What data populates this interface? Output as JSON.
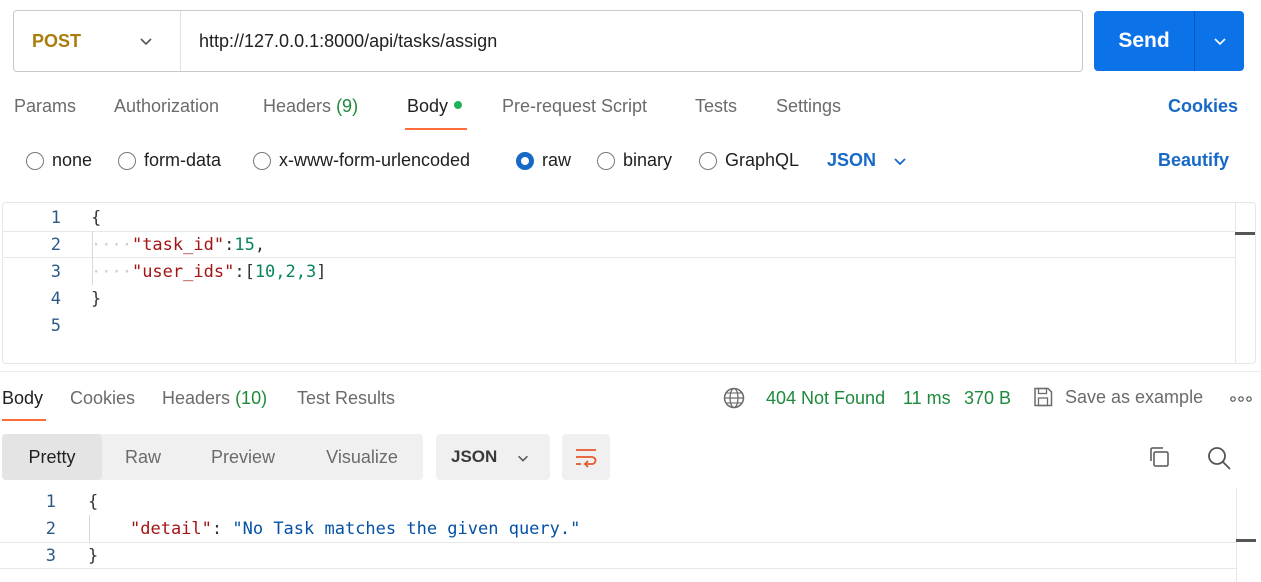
{
  "request": {
    "method": "POST",
    "url": "http://127.0.0.1:8000/api/tasks/assign",
    "send_label": "Send"
  },
  "request_tabs": {
    "params": "Params",
    "authorization": "Authorization",
    "headers": "Headers",
    "headers_count": "(9)",
    "body": "Body",
    "pre_request": "Pre-request Script",
    "tests": "Tests",
    "settings": "Settings",
    "cookies": "Cookies"
  },
  "body_types": {
    "none": "none",
    "form_data": "form-data",
    "urlencoded": "x-www-form-urlencoded",
    "raw": "raw",
    "binary": "binary",
    "graphql": "GraphQL",
    "selected": "raw",
    "language": "JSON",
    "beautify": "Beautify"
  },
  "request_body": {
    "line_numbers": [
      "1",
      "2",
      "3",
      "4",
      "5"
    ],
    "open_brace": "{",
    "key1": "\"task_id\"",
    "colon": ":",
    "val1": "15",
    "comma": ",",
    "key2": "\"user_ids\"",
    "arr_open": "[",
    "arr_vals": "10,2,3",
    "arr_close": "]",
    "close_brace": "}",
    "indent_dots": "····"
  },
  "response_tabs": {
    "body": "Body",
    "cookies": "Cookies",
    "headers": "Headers",
    "headers_count": "(10)",
    "test_results": "Test Results"
  },
  "response_meta": {
    "status": "404 Not Found",
    "time": "11 ms",
    "size": "370 B",
    "save_example": "Save as example"
  },
  "response_view": {
    "pretty": "Pretty",
    "raw": "Raw",
    "preview": "Preview",
    "visualize": "Visualize",
    "format": "JSON"
  },
  "response_body": {
    "line_numbers": [
      "1",
      "2",
      "3"
    ],
    "open_brace": "{",
    "key": "\"detail\"",
    "colon": ": ",
    "value": "\"No Task matches the given query.\"",
    "close_brace": "}"
  },
  "colors": {
    "accent": "#0c72e8",
    "tab_underline": "#ff6c37",
    "status_ok_text": "#1e8a3c",
    "method_post": "#a97c0c"
  }
}
